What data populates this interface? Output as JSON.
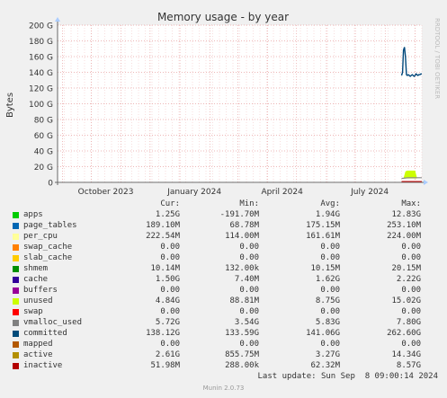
{
  "chart_data": {
    "type": "line",
    "title": "Memory usage - by year",
    "ylabel": "Bytes",
    "side_label": "RRDTOOL / TOBI OETIKER",
    "yticks": [
      "200 G",
      "180 G",
      "160 G",
      "140 G",
      "120 G",
      "100 G",
      "80 G",
      "60 G",
      "40 G",
      "20 G",
      "0"
    ],
    "ylim": [
      0,
      200
    ],
    "xlabels": [
      "October 2023",
      "January 2024",
      "April 2024",
      "July 2024"
    ],
    "x_range": [
      "2023-08-27",
      "2024-09-08"
    ],
    "series": [
      {
        "name": "committed",
        "color": "#00467a",
        "x": [
          "2024-08-18",
          "2024-08-19",
          "2024-08-20",
          "2024-08-21",
          "2024-08-22",
          "2024-08-23",
          "2024-08-24",
          "2024-08-25",
          "2024-08-26",
          "2024-08-27",
          "2024-08-28",
          "2024-08-29",
          "2024-08-30",
          "2024-08-31",
          "2024-09-01",
          "2024-09-02",
          "2024-09-03",
          "2024-09-04",
          "2024-09-05",
          "2024-09-06",
          "2024-09-07",
          "2024-09-08"
        ],
        "values": [
          136,
          140,
          168,
          172,
          160,
          137,
          136,
          137,
          136,
          135,
          136,
          137,
          136,
          135,
          136,
          138,
          137,
          136,
          137,
          137,
          138,
          138
        ]
      },
      {
        "name": "unused",
        "color": "#ccff00",
        "x": [
          "2024-08-20",
          "2024-08-22",
          "2024-08-24",
          "2024-08-26",
          "2024-08-28",
          "2024-08-30",
          "2024-09-01",
          "2024-09-03"
        ],
        "values": [
          5,
          14,
          15,
          15,
          15,
          15,
          15,
          6
        ]
      },
      {
        "name": "vmalloc_used",
        "color": "#888888",
        "x": [
          "2024-08-18",
          "2024-08-25",
          "2024-09-01",
          "2024-09-08"
        ],
        "values": [
          5,
          6,
          6,
          6
        ]
      },
      {
        "name": "page_tables",
        "color": "#0066b3",
        "x": [
          "2024-08-18",
          "2024-09-08"
        ],
        "values": [
          0.2,
          0.2
        ]
      },
      {
        "name": "inactive",
        "color": "#cc0000",
        "x": [
          "2024-08-18",
          "2024-08-28",
          "2024-09-08"
        ],
        "values": [
          1,
          1,
          1
        ]
      }
    ]
  },
  "legend": {
    "headers": [
      "Cur:",
      "Min:",
      "Avg:",
      "Max:"
    ],
    "rows": [
      {
        "name": "apps",
        "color": "#00cc00",
        "cur": "1.25G",
        "min": "-191.70M",
        "avg": "1.94G",
        "max": "12.83G"
      },
      {
        "name": "page_tables",
        "color": "#0066b3",
        "cur": "189.10M",
        "min": "68.78M",
        "avg": "175.15M",
        "max": "253.10M"
      },
      {
        "name": "per_cpu",
        "color": "#ffff99",
        "cur": "222.54M",
        "min": "114.00M",
        "avg": "161.61M",
        "max": "224.00M"
      },
      {
        "name": "swap_cache",
        "color": "#ff8000",
        "cur": "0.00",
        "min": "0.00",
        "avg": "0.00",
        "max": "0.00"
      },
      {
        "name": "slab_cache",
        "color": "#ffcc00",
        "cur": "0.00",
        "min": "0.00",
        "avg": "0.00",
        "max": "0.00"
      },
      {
        "name": "shmem",
        "color": "#008f00",
        "cur": "10.14M",
        "min": "132.00k",
        "avg": "10.15M",
        "max": "20.15M"
      },
      {
        "name": "cache",
        "color": "#330099",
        "cur": "1.50G",
        "min": "7.40M",
        "avg": "1.62G",
        "max": "2.22G"
      },
      {
        "name": "buffers",
        "color": "#990099",
        "cur": "0.00",
        "min": "0.00",
        "avg": "0.00",
        "max": "0.00"
      },
      {
        "name": "unused",
        "color": "#ccff00",
        "cur": "4.84G",
        "min": "88.81M",
        "avg": "8.75G",
        "max": "15.02G"
      },
      {
        "name": "swap",
        "color": "#ff0000",
        "cur": "0.00",
        "min": "0.00",
        "avg": "0.00",
        "max": "0.00"
      },
      {
        "name": "vmalloc_used",
        "color": "#808080",
        "cur": "5.72G",
        "min": "3.54G",
        "avg": "5.83G",
        "max": "7.80G"
      },
      {
        "name": "committed",
        "color": "#004b7a",
        "cur": "138.12G",
        "min": "133.59G",
        "avg": "141.06G",
        "max": "262.60G"
      },
      {
        "name": "mapped",
        "color": "#b35900",
        "cur": "0.00",
        "min": "0.00",
        "avg": "0.00",
        "max": "0.00"
      },
      {
        "name": "active",
        "color": "#b38f00",
        "cur": "2.61G",
        "min": "855.75M",
        "avg": "3.27G",
        "max": "14.34G"
      },
      {
        "name": "inactive",
        "color": "#b30000",
        "cur": "51.98M",
        "min": "288.00k",
        "avg": "62.32M",
        "max": "8.57G"
      }
    ]
  },
  "footer": {
    "last_update": "Last update: Sun Sep  8 09:00:14 2024",
    "munin": "Munin 2.0.73"
  }
}
